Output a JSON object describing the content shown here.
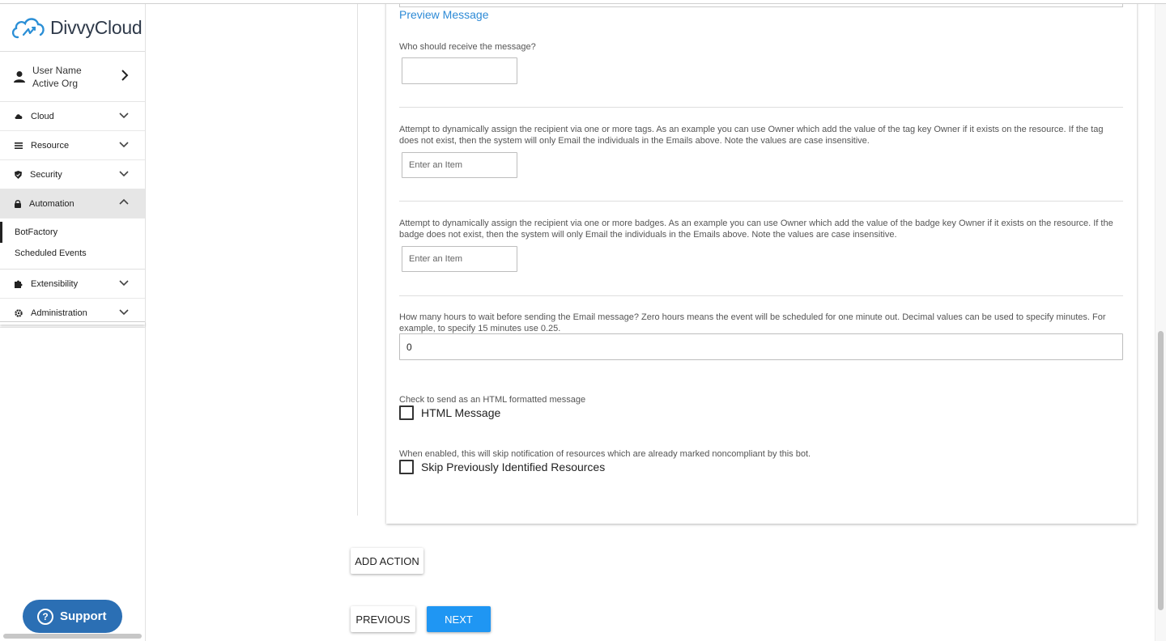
{
  "brand": {
    "name": "DivvyCloud"
  },
  "user": {
    "name": "User Name",
    "org": "Active Org"
  },
  "nav": {
    "cloud": "Cloud",
    "resource": "Resource",
    "security": "Security",
    "automation": "Automation",
    "botfactory": "BotFactory",
    "scheduled_events": "Scheduled Events",
    "extensibility": "Extensibility",
    "administration": "Administration"
  },
  "support": {
    "label": "Support"
  },
  "form": {
    "preview_link": "Preview Message",
    "recipient_label": "Who should receive the message?",
    "recipient_value": "",
    "tags_label": "Attempt to dynamically assign the recipient via one or more tags. As an example you can use Owner which add the value of the tag key Owner if it exists on the resource. If the tag does not exist, then the system will only Email the individuals in the Emails above. Note the values are case insensitive.",
    "tags_placeholder": "Enter an Item",
    "badges_label": "Attempt to dynamically assign the recipient via one or more badges. As an example you can use Owner which add the value of the badge key Owner if it exists on the resource. If the badge does not exist, then the system will only Email the individuals in the Emails above. Note the values are case insensitive.",
    "badges_placeholder": "Enter an Item",
    "hours_label": "How many hours to wait before sending the Email message? Zero hours means the event will be scheduled for one minute out. Decimal values can be used to specify minutes. For example, to specify 15 minutes use 0.25.",
    "hours_value": "0",
    "html_hint": "Check to send as an HTML formatted message",
    "html_label": "HTML Message",
    "html_checked": false,
    "skip_hint": "When enabled, this will skip notification of resources which are already marked noncompliant by this bot.",
    "skip_label": "Skip Previously Identified Resources",
    "skip_checked": false
  },
  "buttons": {
    "add_action": "ADD ACTION",
    "previous": "PREVIOUS",
    "next": "NEXT"
  },
  "colors": {
    "link": "#2d8ad6",
    "primary": "#1f96f3",
    "support": "#2b6fb4"
  }
}
